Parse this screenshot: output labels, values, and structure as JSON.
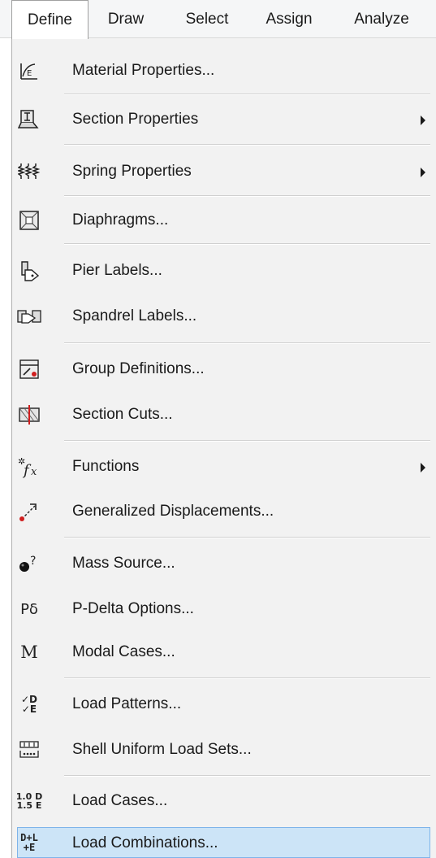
{
  "menubar": {
    "items": [
      {
        "label": "Define",
        "active": true
      },
      {
        "label": "Draw"
      },
      {
        "label": "Select"
      },
      {
        "label": "Assign"
      },
      {
        "label": "Analyze"
      }
    ]
  },
  "menu": {
    "items": [
      {
        "label": "Material Properties...",
        "icon": "material-properties-icon"
      },
      {
        "label": "Section Properties",
        "icon": "section-properties-icon",
        "submenu": true
      },
      {
        "label": "Spring Properties",
        "icon": "spring-properties-icon",
        "submenu": true
      },
      {
        "label": "Diaphragms...",
        "icon": "diaphragm-icon"
      },
      {
        "label": "Pier Labels...",
        "icon": "pier-labels-icon"
      },
      {
        "label": "Spandrel Labels...",
        "icon": "spandrel-labels-icon"
      },
      {
        "label": "Group Definitions...",
        "icon": "group-definitions-icon"
      },
      {
        "label": "Section Cuts...",
        "icon": "section-cuts-icon"
      },
      {
        "label": "Functions",
        "icon": "functions-icon",
        "submenu": true
      },
      {
        "label": "Generalized Displacements...",
        "icon": "generalized-displacements-icon"
      },
      {
        "label": "Mass Source...",
        "icon": "mass-source-icon"
      },
      {
        "label": "P-Delta Options...",
        "icon": "p-delta-icon",
        "icon_text": "Pδ"
      },
      {
        "label": "Modal Cases...",
        "icon": "modal-cases-icon",
        "icon_text": "M"
      },
      {
        "label": "Load Patterns...",
        "icon": "load-patterns-icon",
        "icon_text_1": "✓D",
        "icon_text_2": "✓E"
      },
      {
        "label": "Shell Uniform Load Sets...",
        "icon": "shell-uniform-load-icon"
      },
      {
        "label": "Load Cases...",
        "icon": "load-cases-icon",
        "icon_text_1": "1.0 D",
        "icon_text_2": "1.5 E"
      },
      {
        "label": "Load Combinations...",
        "icon": "load-combinations-icon",
        "icon_text_1": "D+L",
        "icon_text_2": "+E",
        "highlighted": true
      }
    ]
  },
  "colors": {
    "menubar_bg": "#f5f6f7",
    "dropdown_bg": "#f2f2f2",
    "highlight_bg": "#cce4f7",
    "highlight_border": "#7eb4ea",
    "accent_red": "#d01f1f"
  }
}
